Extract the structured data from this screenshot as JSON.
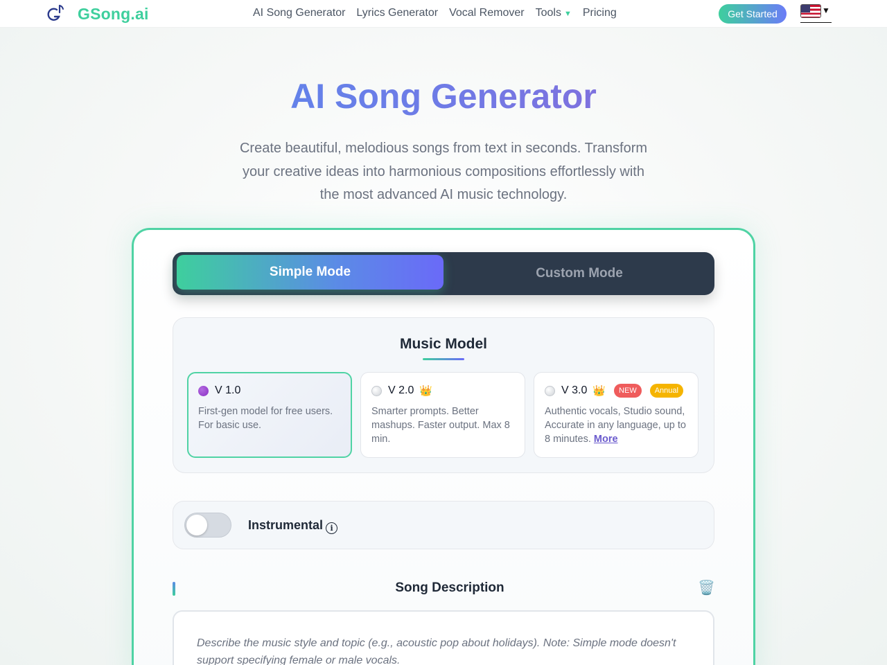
{
  "nav": {
    "brand": "GSong.ai",
    "links": [
      "AI Song Generator",
      "Lyrics Generator",
      "Vocal Remover",
      "Tools",
      "Pricing"
    ],
    "tools_caret": "▼",
    "get_started": "Get Started",
    "language_caret": "▾"
  },
  "hero": {
    "title": "AI Song Generator",
    "subtitle": "Create beautiful, melodious songs from text in seconds. Transform your creative ideas into harmonious compositions effortlessly with the most advanced AI music technology."
  },
  "modes": {
    "simple": "Simple Mode",
    "custom": "Custom Mode",
    "active": "simple"
  },
  "model": {
    "title": "Music Model",
    "options": [
      {
        "name": "V 1.0",
        "desc": "First-gen model for free users. For basic use.",
        "selected": true
      },
      {
        "name": "V 2.0",
        "crown": "👑",
        "desc": "Smarter prompts. Better mashups. Faster output. Max 8 min."
      },
      {
        "name": "V 3.0",
        "crown": "👑",
        "badge_new": "NEW",
        "badge_annual": "Annual",
        "desc": "Authentic vocals, Studio sound, Accurate in any language, up to 8 minutes.",
        "more": "More"
      }
    ]
  },
  "instrumental": {
    "label": "Instrumental",
    "info": "i",
    "enabled": false
  },
  "description": {
    "title": "Song Description",
    "placeholder": "Describe the music style and topic (e.g., acoustic pop about holidays). Note: Simple mode doesn't support specifying female or male vocals."
  },
  "colors": {
    "brand": "#3ecf9d",
    "accent": "#6a6af8",
    "dark": "#2d3a4b"
  }
}
